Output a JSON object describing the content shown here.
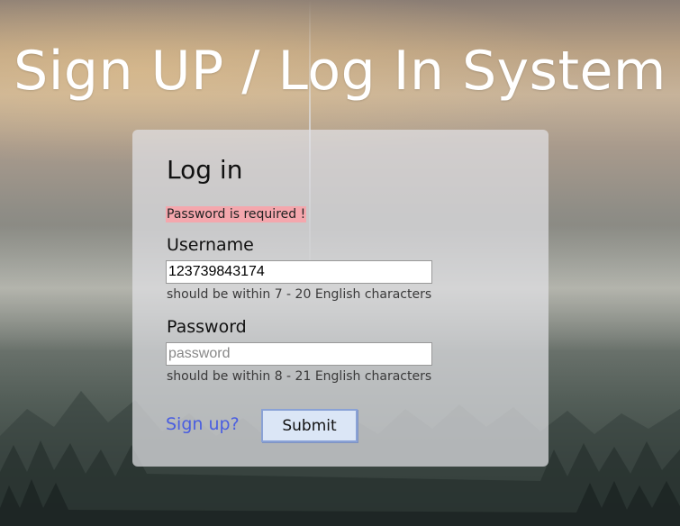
{
  "page": {
    "title": "Sign UP / Log In System"
  },
  "login_card": {
    "heading": "Log in",
    "error_message": "Password is required !",
    "username": {
      "label": "Username",
      "value": "123739843174",
      "placeholder": "",
      "hint": "should be within 7 - 20 English characters"
    },
    "password": {
      "label": "Password",
      "value": "",
      "placeholder": "password",
      "hint": "should be within 8 - 21 English characters"
    },
    "signup_link": "Sign up?",
    "submit_label": "Submit"
  },
  "colors": {
    "title_text": "#ffffff",
    "error_background": "#f4a7ad",
    "link": "#4a5ee0",
    "button_background": "#dbe6f6",
    "button_border": "#8aa2d6",
    "card_background": "rgba(225,225,228,0.72)"
  }
}
